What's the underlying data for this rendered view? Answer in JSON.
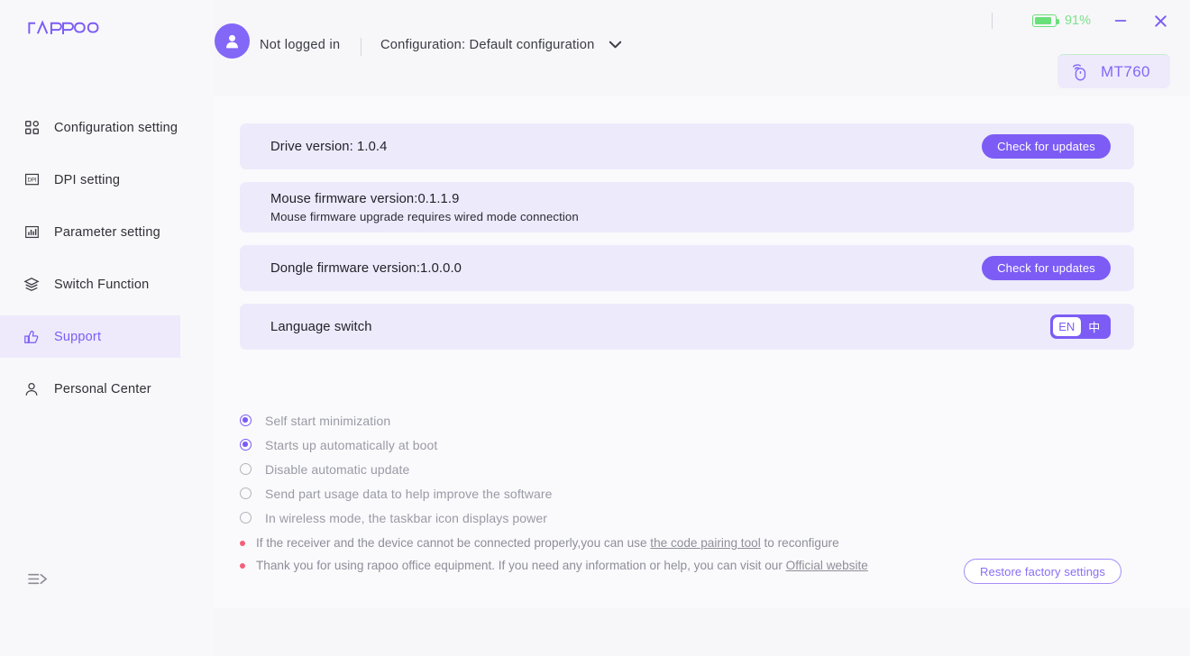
{
  "brand": {
    "logo_text": "rapoo",
    "accent": "#7c5cf5",
    "row_bg": "#edeafb"
  },
  "sidebar": {
    "items": [
      {
        "label": "Configuration setting",
        "icon": "grid-icon",
        "active": false
      },
      {
        "label": "DPI setting",
        "icon": "dpi-icon",
        "active": false
      },
      {
        "label": "Parameter setting",
        "icon": "bar-chart-icon",
        "active": false
      },
      {
        "label": "Switch Function",
        "icon": "layers-icon",
        "active": false
      },
      {
        "label": "Support",
        "icon": "thumbs-up-icon",
        "active": true
      },
      {
        "label": "Personal Center",
        "icon": "user-icon",
        "active": false
      }
    ],
    "collapse_icon": "collapse-sidebar-icon"
  },
  "header": {
    "avatar_icon": "user-avatar-icon",
    "login_status": "Not logged in",
    "config_label": "Configuration: Default configuration",
    "config_chevron_icon": "chevron-down-icon",
    "battery": {
      "icon": "battery-icon",
      "percent": "91%",
      "level": 91,
      "color": "#7fe08c"
    },
    "minimize_icon": "minimize-icon",
    "close_icon": "close-icon",
    "device": {
      "icon": "wireless-mouse-icon",
      "name": "MT760"
    }
  },
  "main": {
    "rows": [
      {
        "title": "Drive version: 1.0.4",
        "sub": "",
        "action": "Check for updates"
      },
      {
        "title": "Mouse firmware version:0.1.1.9",
        "sub": "Mouse firmware upgrade requires wired mode connection",
        "action": ""
      },
      {
        "title": "Dongle firmware version:1.0.0.0",
        "sub": "",
        "action": "Check for updates"
      },
      {
        "title": "Language switch",
        "sub": "",
        "action": ""
      }
    ],
    "language_toggle": {
      "options": [
        "EN",
        "中"
      ],
      "selected": "EN"
    },
    "options": [
      {
        "label": "Self start minimization",
        "checked": true
      },
      {
        "label": "Starts up automatically at boot",
        "checked": true
      },
      {
        "label": "Disable automatic update",
        "checked": false
      },
      {
        "label": "Send part usage data to help improve the software",
        "checked": false
      },
      {
        "label": "In wireless mode, the taskbar icon displays power",
        "checked": false
      }
    ],
    "notes": [
      {
        "pre": "If the receiver and the device cannot be connected properly,you can use ",
        "link": "the code pairing tool",
        "post": " to reconfigure"
      },
      {
        "pre": "Thank you for using rapoo office equipment. If you need any information or help, you can visit our ",
        "link": "Official website",
        "post": ""
      }
    ],
    "restore_label": "Restore factory settings"
  }
}
